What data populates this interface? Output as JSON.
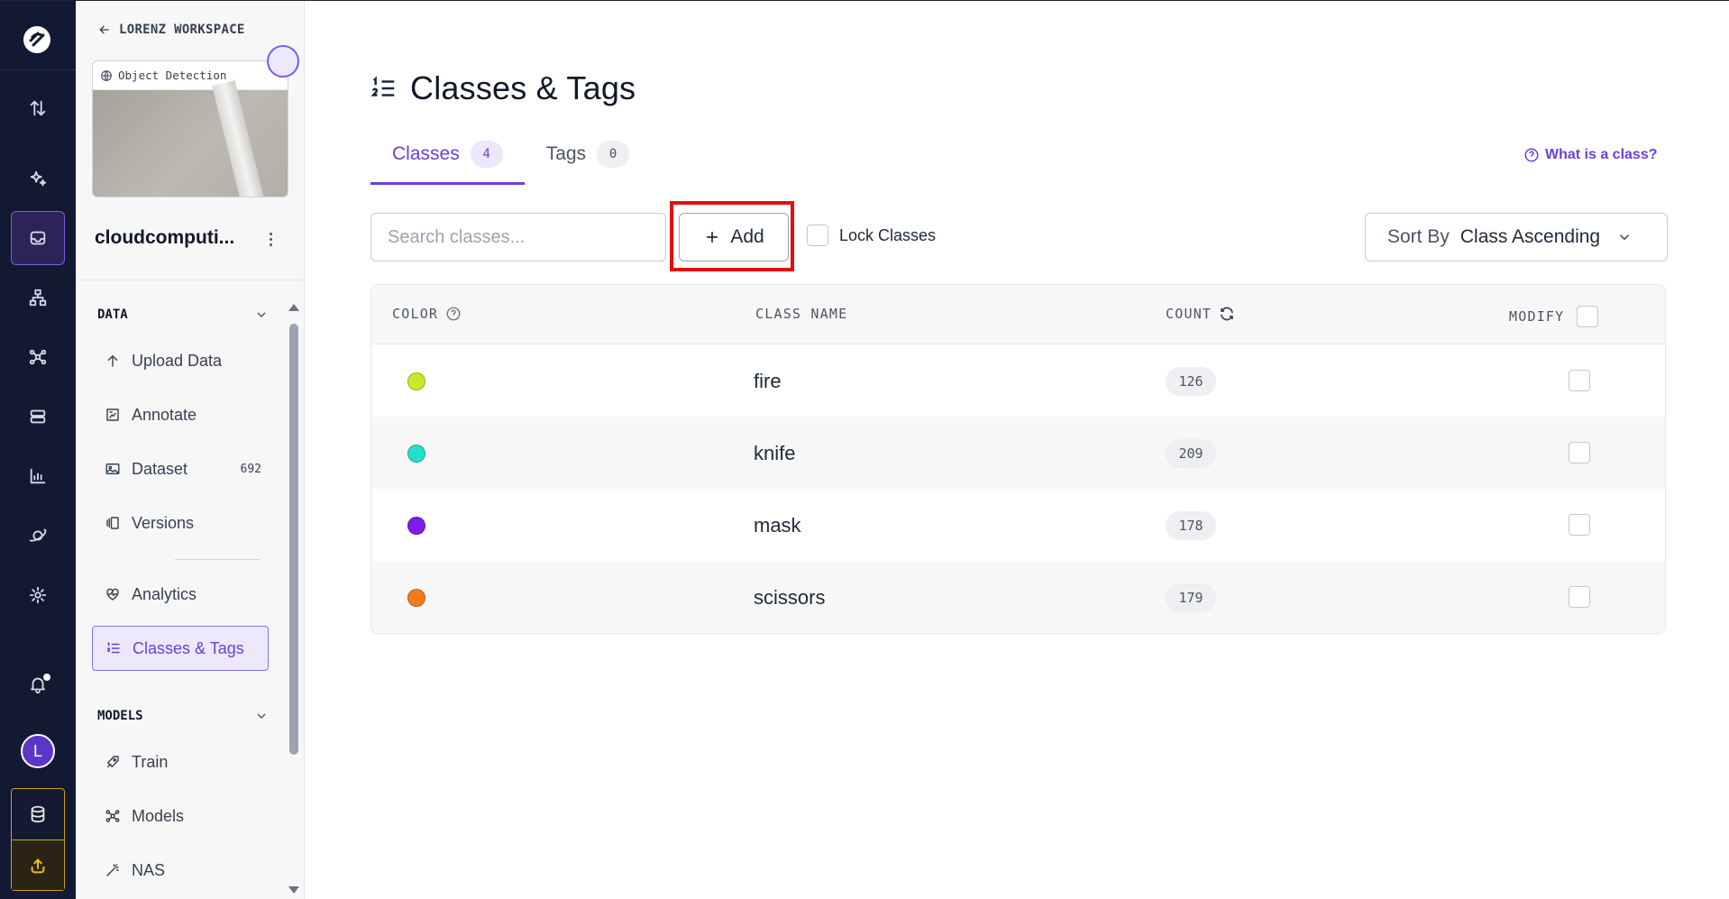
{
  "sidebar": {
    "back_label": "LORENZ WORKSPACE",
    "project_type": "Object Detection",
    "project_name": "cloudcomputi...",
    "sections": {
      "data_label": "DATA",
      "models_label": "MODELS"
    },
    "items": {
      "upload": "Upload Data",
      "annotate": "Annotate",
      "dataset": "Dataset",
      "dataset_count": "692",
      "versions": "Versions",
      "analytics": "Analytics",
      "classes": "Classes & Tags",
      "train": "Train",
      "models": "Models",
      "nas": "NAS"
    }
  },
  "rail": {
    "avatar_letter": "L",
    "icons": [
      "logo-icon",
      "sort-arrows-icon",
      "sparkle-icon",
      "inbox-icon",
      "hierarchy-icon",
      "network-icon",
      "server-icon",
      "bar-chart-icon",
      "planet-icon",
      "gear-icon",
      "bell-icon",
      "database-icon",
      "upload-icon"
    ]
  },
  "page": {
    "title": "Classes & Tags",
    "tabs": [
      {
        "label": "Classes",
        "count": "4"
      },
      {
        "label": "Tags",
        "count": "0"
      }
    ],
    "help_label": "What is a class?"
  },
  "toolbar": {
    "search_placeholder": "Search classes...",
    "add_label": "Add",
    "lock_label": "Lock Classes",
    "sort_label": "Sort By",
    "sort_value": "Class Ascending"
  },
  "table": {
    "headers": {
      "color": "COLOR",
      "class_name": "CLASS NAME",
      "count": "COUNT",
      "modify": "MODIFY"
    },
    "rows": [
      {
        "color": "#c6ea2a",
        "name": "fire",
        "count": "126"
      },
      {
        "color": "#23e0c8",
        "name": "knife",
        "count": "209"
      },
      {
        "color": "#7a1ee8",
        "name": "mask",
        "count": "178"
      },
      {
        "color": "#f47c1c",
        "name": "scissors",
        "count": "179"
      }
    ]
  },
  "colors": {
    "accent": "#6d3fd7",
    "rail_bg": "#121932",
    "highlight": "#e01010"
  }
}
